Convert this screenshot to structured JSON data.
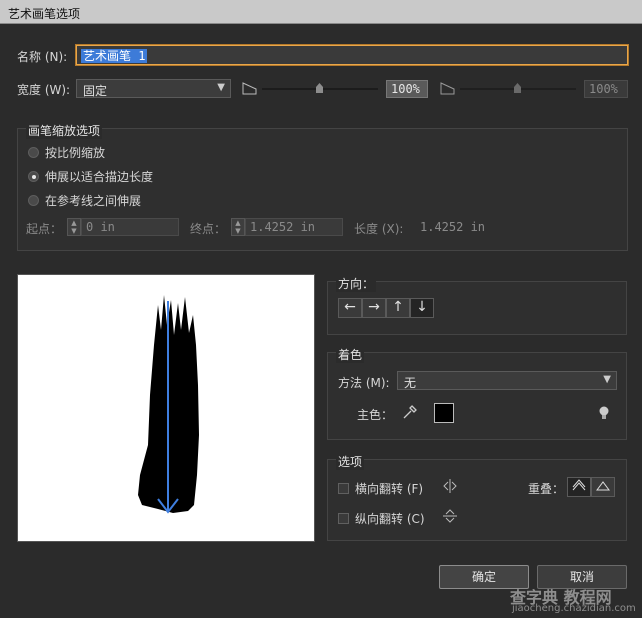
{
  "window": {
    "title": "艺术画笔选项"
  },
  "name": {
    "label": "名称 (N):",
    "value": "艺术画笔 1"
  },
  "width": {
    "label": "宽度 (W):",
    "mode": "固定",
    "value1": "100%",
    "value2": "100%"
  },
  "scale_options": {
    "title": "画笔缩放选项",
    "items": [
      {
        "label": "按比例缩放",
        "selected": false
      },
      {
        "label": "伸展以适合描边长度",
        "selected": true
      },
      {
        "label": "在参考线之间伸展",
        "selected": false
      }
    ],
    "start_label": "起点：",
    "start_value": "0 in",
    "end_label": "终点：",
    "end_value": "1.4252 in",
    "length_label": "长度 (X):",
    "length_value": "1.4252 in"
  },
  "direction": {
    "title": "方向：",
    "buttons": [
      "←",
      "→",
      "↑",
      "↓"
    ],
    "selected_index": 3
  },
  "coloring": {
    "title": "着色",
    "method_label": "方法 (M):",
    "method_value": "无",
    "key_color_label": "主色：",
    "key_color": "#000000"
  },
  "options": {
    "title": "选项",
    "flip_h_label": "横向翻转 (F)",
    "flip_v_label": "纵向翻转 (C)",
    "overlap_label": "重叠："
  },
  "buttons": {
    "ok": "确定",
    "cancel": "取消"
  },
  "watermark": {
    "line1": "查字典 教程网",
    "line2": "jiaocheng.chazidian.com"
  },
  "colors": {
    "accent": "#e8a64a",
    "selection": "#3d7bd8",
    "arrow": "#3f7fe0"
  }
}
